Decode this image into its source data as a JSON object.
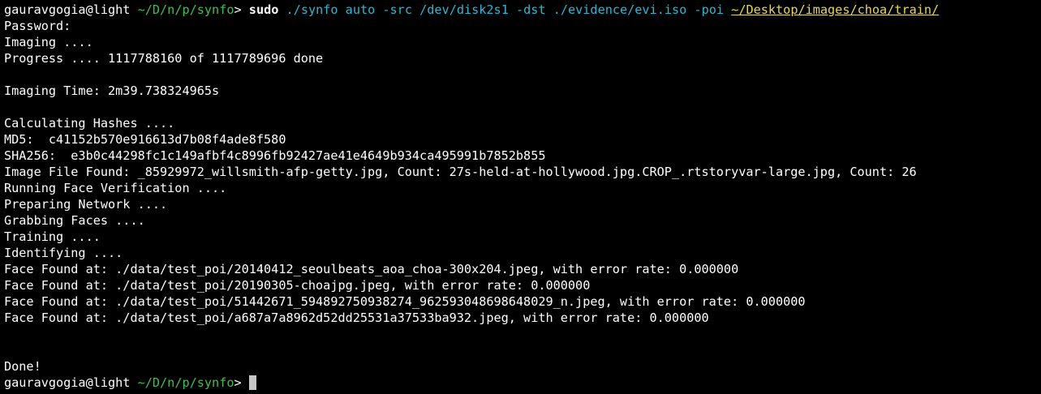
{
  "prompt": {
    "user_host": "gauravgogia@light",
    "path": "~/D/n/p/synfo",
    "symbol": ">"
  },
  "command": {
    "sudo": "sudo",
    "args": "./synfo auto -src /dev/disk2s1 -dst ./evidence/evi.iso -poi",
    "path_arg": "~/Desktop/images/choa/train/"
  },
  "output": [
    "Password:",
    "Imaging ....",
    "Progress .... 1117788160 of 1117789696 done",
    "",
    "Imaging Time: 2m39.738324965s",
    "",
    "Calculating Hashes ....",
    "MD5:  c41152b570e916613d7b08f4ade8f580",
    "SHA256:  e3b0c44298fc1c149afbf4c8996fb92427ae41e4649b934ca495991b7852b855",
    "Image File Found: _85929972_willsmith-afp-getty.jpg, Count: 27s-held-at-hollywood.jpg.CROP_.rtstoryvar-large.jpg, Count: 26",
    "Running Face Verification ....",
    "Preparing Network ....",
    "Grabbing Faces ....",
    "Training ....",
    "Identifying ....",
    "Face Found at: ./data/test_poi/20140412_seoulbeats_aoa_choa-300x204.jpeg, with error rate: 0.000000",
    "Face Found at: ./data/test_poi/20190305-choajpg.jpeg, with error rate: 0.000000",
    "Face Found at: ./data/test_poi/51442671_594892750938274_962593048698648029_n.jpeg, with error rate: 0.000000",
    "Face Found at: ./data/test_poi/a687a7a8962d52dd25531a37533ba932.jpeg, with error rate: 0.000000",
    "",
    "",
    "Done!"
  ],
  "colors": {
    "background": "#000000",
    "text": "#ffffff",
    "path": "#39c447",
    "argument": "#2ab8d6",
    "path_argument": "#e6d94a"
  }
}
